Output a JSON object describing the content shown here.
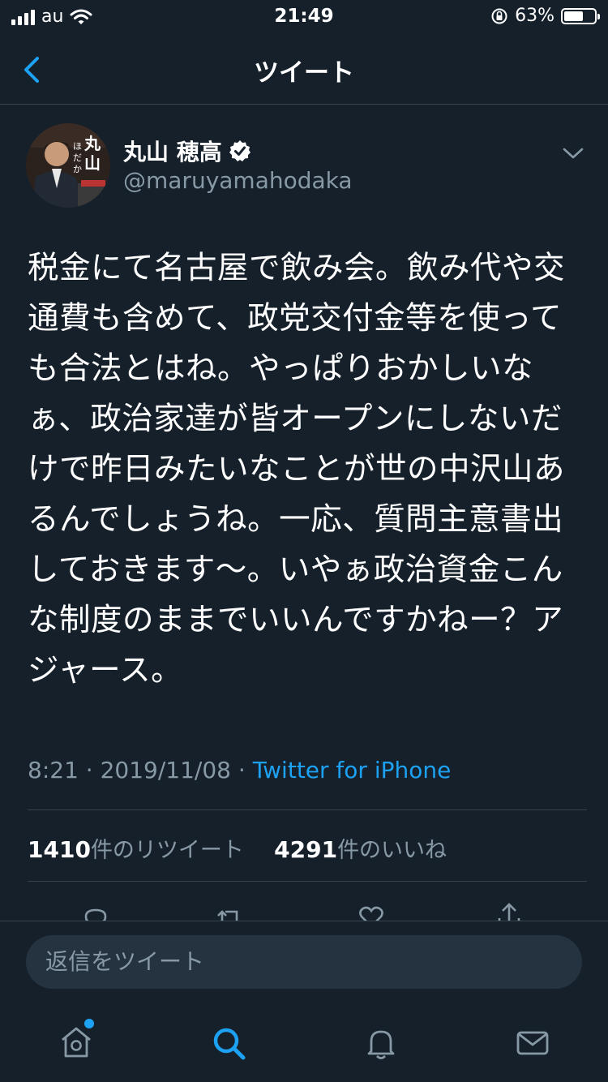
{
  "status_bar": {
    "carrier": "au",
    "time": "21:49",
    "battery_percent": "63%",
    "battery_level": 0.63
  },
  "nav": {
    "title": "ツイート",
    "back_icon": "chevron-left-icon"
  },
  "tweet": {
    "author_name": "丸山 穂高",
    "author_handle": "@maruyamahodaka",
    "avatar_text": "丸山 ほだか",
    "text": "税金にて名古屋で飲み会。飲み代や交通費も含めて、政党交付金等を使っても合法とはね。やっぱりおかしいなぁ、政治家達が皆オープンにしないだけで昨日みたいなことが世の中沢山あるんでしょうね。一応、質問主意書出しておきます〜。いやぁ政治資金こんな制度のままでいいんですかねー？アジャース。",
    "time": "8:21",
    "separator": " · ",
    "date": "2019/11/08",
    "source": "Twitter for iPhone",
    "retweet_count": "1410",
    "retweet_label": "件のリツイート",
    "like_count": "4291",
    "like_label": "件のいいね"
  },
  "reply": {
    "placeholder": "返信をツイート"
  },
  "tabs": [
    {
      "name": "home",
      "icon": "home-icon"
    },
    {
      "name": "search",
      "icon": "search-icon"
    },
    {
      "name": "notifications",
      "icon": "bell-icon"
    },
    {
      "name": "messages",
      "icon": "mail-icon"
    }
  ],
  "colors": {
    "background": "#15202b",
    "accent": "#1da1f2",
    "secondary_text": "#8899a6",
    "divider": "#38444d"
  }
}
